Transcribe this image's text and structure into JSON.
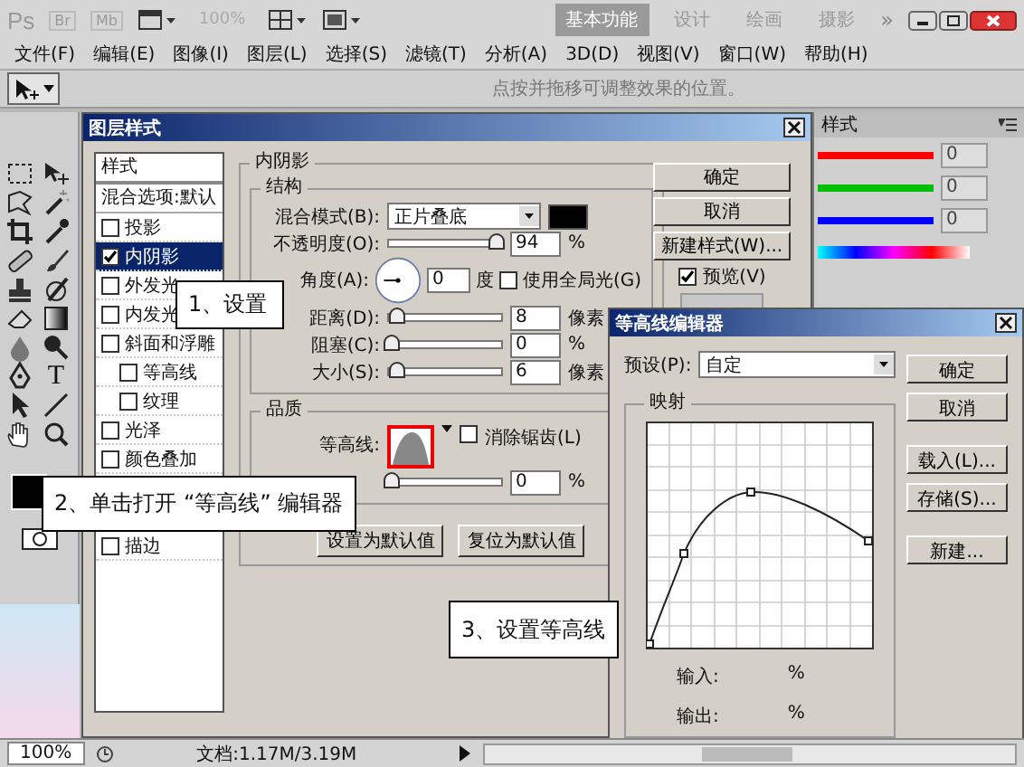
{
  "app_bar": {
    "logo": "Ps",
    "bridge": "Br",
    "mini": "Mb",
    "zoom": "100%",
    "more": "»",
    "workspaces": [
      {
        "label": "基本功能",
        "selected": true
      },
      {
        "label": "设计",
        "selected": false
      },
      {
        "label": "绘画",
        "selected": false
      },
      {
        "label": "摄影",
        "selected": false
      }
    ]
  },
  "menu": [
    "文件(F)",
    "编辑(E)",
    "图像(I)",
    "图层(L)",
    "选择(S)",
    "滤镜(T)",
    "分析(A)",
    "3D(D)",
    "视图(V)",
    "窗口(W)",
    "帮助(H)"
  ],
  "options_bar": {
    "hint": "点按并拖移可调整效果的位置。"
  },
  "toolbar": {
    "type_glyph": "T"
  },
  "layer_style": {
    "title": "图层样式",
    "styles_header": "样式",
    "blend_options": "混合选项:默认",
    "effects": [
      {
        "label": "投影",
        "checked": false,
        "selected": false
      },
      {
        "label": "内阴影",
        "checked": true,
        "selected": true
      },
      {
        "label": "外发光",
        "checked": false,
        "selected": false
      },
      {
        "label": "内发光",
        "checked": false,
        "selected": false
      },
      {
        "label": "斜面和浮雕",
        "checked": false,
        "selected": false,
        "children": [
          {
            "label": "等高线",
            "checked": false,
            "selected": false
          },
          {
            "label": "纹理",
            "checked": false,
            "selected": false
          }
        ]
      },
      {
        "label": "光泽",
        "checked": false,
        "selected": false
      },
      {
        "label": "颜色叠加",
        "checked": false,
        "selected": false
      },
      {
        "label": "描边",
        "checked": false,
        "selected": false
      }
    ],
    "section_title": "内阴影",
    "structure_title": "结构",
    "blend_mode": {
      "label": "混合模式(B):",
      "value": "正片叠底"
    },
    "opacity": {
      "label": "不透明度(O):",
      "level": 0.94,
      "value": "94",
      "unit": "%"
    },
    "angle": {
      "label": "角度(A):",
      "value": "0",
      "unit": "度",
      "global_light": {
        "label": "使用全局光(G)",
        "checked": false
      }
    },
    "sliders": [
      {
        "label": "距离(D):",
        "level": 0.05,
        "value": "8",
        "unit": "像素"
      },
      {
        "label": "阻塞(C):",
        "level": 0,
        "value": "0",
        "unit": "%"
      },
      {
        "label": "大小(S):",
        "level": 0.05,
        "value": "6",
        "unit": "像素"
      }
    ],
    "quality_title": "品质",
    "contour_label": "等高线:",
    "anti_alias": {
      "label": "消除锯齿(L)",
      "checked": false
    },
    "noise": {
      "level": 0,
      "value": "0",
      "unit": "%"
    },
    "default_buttons": [
      "设置为默认值",
      "复位为默认值"
    ],
    "side_buttons": [
      "确定",
      "取消",
      "新建样式(W)..."
    ],
    "preview": {
      "label": "预览(V)",
      "checked": true
    }
  },
  "color_panel": {
    "tab": "样式",
    "channels": [
      {
        "value": "0",
        "color": "#ff0000"
      },
      {
        "value": "0",
        "color": "#00c000"
      },
      {
        "value": "0",
        "color": "#0000ff"
      }
    ]
  },
  "contour_editor": {
    "title": "等高线编辑器",
    "preset": {
      "label": "预设(P):",
      "value": "自定"
    },
    "mapping_title": "映射",
    "input": {
      "label": "输入:",
      "unit": "%"
    },
    "output": {
      "label": "输出:",
      "unit": "%"
    },
    "buttons": [
      "确定",
      "取消",
      "载入(L)...",
      "存储(S)...",
      "新建..."
    ]
  },
  "callouts": [
    "1、设置",
    "2、单击打开 “等高线” 编辑器",
    "3、设置等高线"
  ],
  "status_bar": {
    "zoom": "100%",
    "doc": "文档:1.17M/3.19M"
  }
}
